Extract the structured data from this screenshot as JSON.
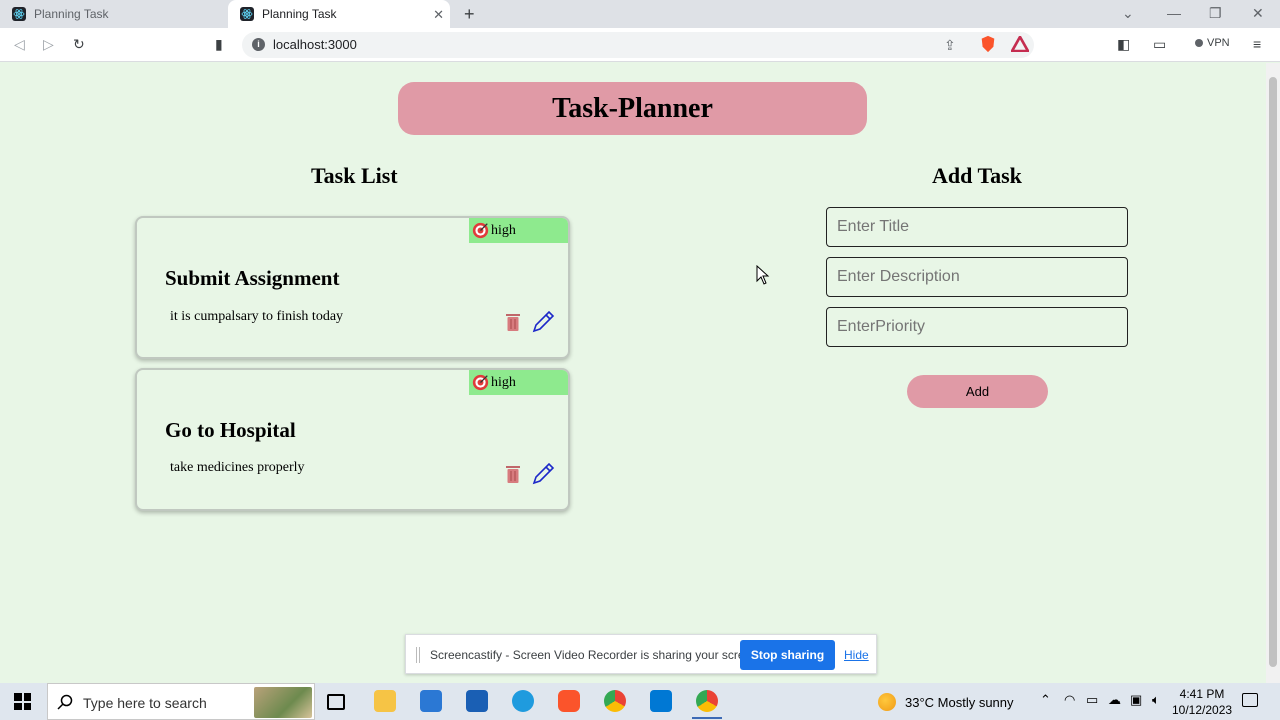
{
  "browser": {
    "tabs": [
      {
        "label": "Planning Task",
        "active": false
      },
      {
        "label": "Planning Task",
        "active": true
      }
    ],
    "url": "localhost:3000",
    "vpn_label": "VPN"
  },
  "app": {
    "header": "Task-Planner",
    "task_list_title": "Task List",
    "add_task_title": "Add Task",
    "tasks": [
      {
        "title": "Submit Assignment",
        "description": "it is cumpalsary to finish today",
        "priority": "high"
      },
      {
        "title": "Go to Hospital",
        "description": "take medicines properly",
        "priority": "high"
      }
    ],
    "form": {
      "title_placeholder": "Enter Title",
      "description_placeholder": "Enter Description",
      "priority_placeholder": "EnterPriority",
      "add_label": "Add"
    }
  },
  "share_bar": {
    "message": "Screencastify - Screen Video Recorder is sharing your screen.",
    "stop_label": "Stop sharing",
    "hide_label": "Hide"
  },
  "taskbar": {
    "search_placeholder": "Type here to search",
    "weather": "33°C  Mostly sunny",
    "time": "4:41 PM",
    "date": "10/12/2023"
  },
  "colors": {
    "page_bg": "#e8f6e6",
    "accent_pink": "#e09aa6",
    "priority_green": "#8eea8e",
    "link_blue": "#1a73e8"
  }
}
